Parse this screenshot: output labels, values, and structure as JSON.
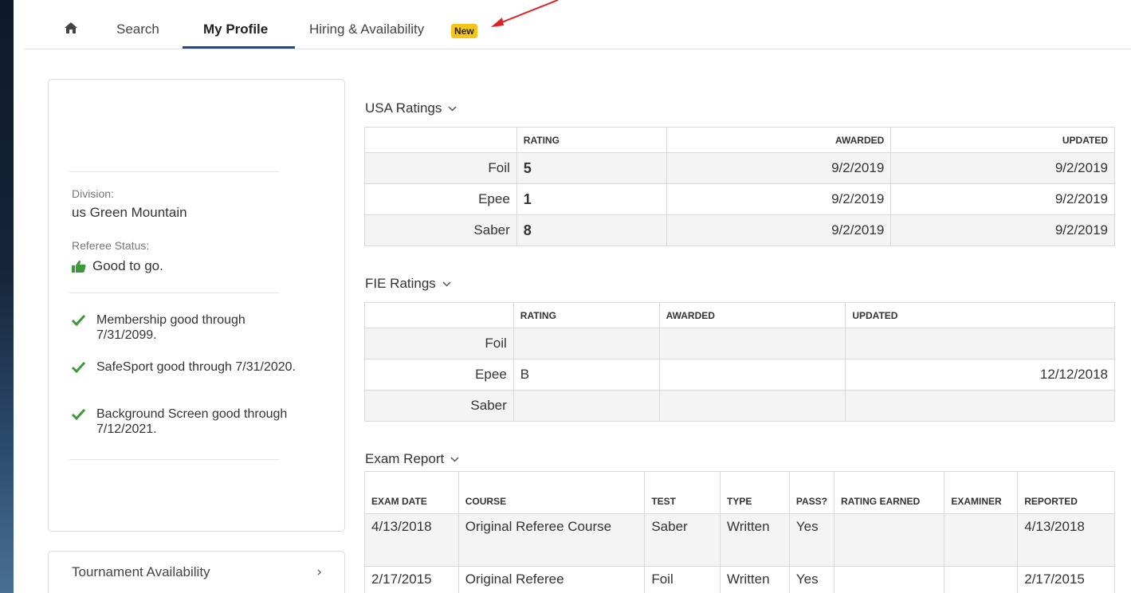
{
  "nav": {
    "home_icon": "home-icon",
    "tabs": [
      {
        "label": "Search"
      },
      {
        "label": "My Profile"
      },
      {
        "label": "Hiring & Availability"
      }
    ],
    "badge": "New",
    "badge_color": "#f5c518",
    "accent_color": "#2b4a6b"
  },
  "profile": {
    "division_label": "Division:",
    "division_value": "us Green Mountain",
    "status_label": "Referee Status:",
    "status_value": "Good to go.",
    "status_icon": "thumbs-up-icon",
    "checks": [
      {
        "text": "Membership good through 7/31/2099."
      },
      {
        "text": "SafeSport good through 7/31/2020."
      },
      {
        "text": "Background Screen good through 7/12/2021."
      }
    ],
    "check_color": "#3a9a3a"
  },
  "availability": {
    "label": "Tournament Availability",
    "chevron": "›"
  },
  "usa_ratings": {
    "title": "USA Ratings",
    "headers": [
      "RATING",
      "AWARDED",
      "UPDATED"
    ],
    "rows": [
      {
        "weapon": "Foil",
        "rating": "5",
        "awarded": "9/2/2019",
        "updated": "9/2/2019"
      },
      {
        "weapon": "Epee",
        "rating": "1",
        "awarded": "9/2/2019",
        "updated": "9/2/2019"
      },
      {
        "weapon": "Saber",
        "rating": "8",
        "awarded": "9/2/2019",
        "updated": "9/2/2019"
      }
    ]
  },
  "fie_ratings": {
    "title": "FIE Ratings",
    "headers": [
      "RATING",
      "AWARDED",
      "UPDATED"
    ],
    "rows": [
      {
        "weapon": "Foil",
        "rating": "",
        "awarded": "",
        "updated": ""
      },
      {
        "weapon": "Epee",
        "rating": "B",
        "awarded": "",
        "updated": "12/12/2018"
      },
      {
        "weapon": "Saber",
        "rating": "",
        "awarded": "",
        "updated": ""
      }
    ]
  },
  "exam_report": {
    "title": "Exam Report",
    "headers": [
      "EXAM DATE",
      "COURSE",
      "TEST",
      "TYPE",
      "PASS?",
      "RATING EARNED",
      "EXAMINER",
      "REPORTED"
    ],
    "rows": [
      {
        "date": "4/13/2018",
        "course": "Original Referee Course",
        "test": "Saber",
        "type": "Written",
        "pass": "Yes",
        "earned": "",
        "examiner": "",
        "reported": "4/13/2018"
      },
      {
        "date": "2/17/2015",
        "course": "Original Referee",
        "test": "Foil",
        "type": "Written",
        "pass": "Yes",
        "earned": "",
        "examiner": "",
        "reported": "2/17/2015"
      }
    ]
  }
}
